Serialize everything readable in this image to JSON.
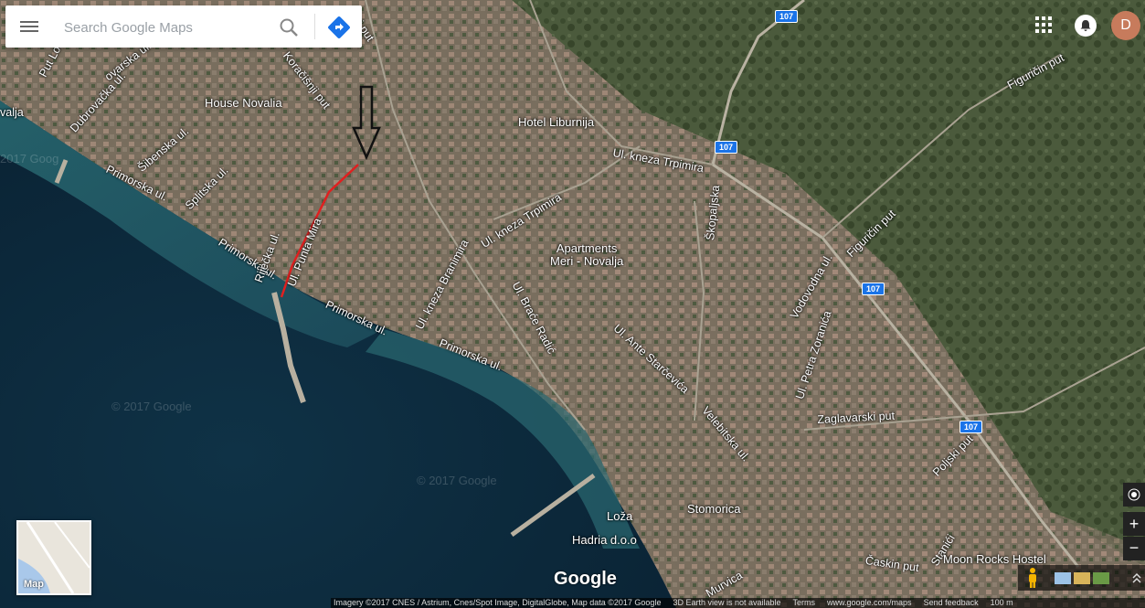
{
  "search": {
    "placeholder": "Search Google Maps"
  },
  "account": {
    "initial": "D"
  },
  "map": {
    "labels": [
      {
        "id": "put-loke",
        "text": "Put Loke"
      },
      {
        "id": "dubrovacka",
        "text": "Dubrovačka ul."
      },
      {
        "id": "ovarska",
        "text": "ovarska ul."
      },
      {
        "id": "novalja",
        "text": "valja"
      },
      {
        "id": "sibenska",
        "text": "Šibenska ul."
      },
      {
        "id": "splitska",
        "text": "Splitska ul."
      },
      {
        "id": "primorska-1",
        "text": "Primorska ul."
      },
      {
        "id": "primorska-2",
        "text": "Primorska ul."
      },
      {
        "id": "primorska-3",
        "text": "Primorska ul."
      },
      {
        "id": "primorska-4",
        "text": "Primorska ul."
      },
      {
        "id": "rijecka",
        "text": "Riječka ul."
      },
      {
        "id": "punta-mira",
        "text": "Ul. Punta Mira"
      },
      {
        "id": "house-novalia",
        "text": "House Novalia"
      },
      {
        "id": "koracisnji",
        "text": "Koračišnji put"
      },
      {
        "id": "ski-put",
        "text": "ški put"
      },
      {
        "id": "hotel-liburnija",
        "text": "Hotel Liburnija"
      },
      {
        "id": "kneza-trpimira-1",
        "text": "Ul. kneza Trpimira"
      },
      {
        "id": "kneza-trpimira-2",
        "text": "Ul. kneza Trpimira"
      },
      {
        "id": "kneza-branimira",
        "text": "Ul. kneza Branimira"
      },
      {
        "id": "apartments-meri",
        "text": "Apartments\nMeri - Novalja"
      },
      {
        "id": "braee-radic",
        "text": "Ul. Braće Radić"
      },
      {
        "id": "ante-starcevica",
        "text": "Ul. Ante Starčevića"
      },
      {
        "id": "skopaljska",
        "text": "Škopaljska"
      },
      {
        "id": "vodovodna",
        "text": "Vodovodna ul."
      },
      {
        "id": "petra-zoranica",
        "text": "Ul. Petra Zoranića"
      },
      {
        "id": "figurcin-1",
        "text": "Figuričin put"
      },
      {
        "id": "figurcin-2",
        "text": "Figuričin put"
      },
      {
        "id": "velebitska",
        "text": "Velebitska ul."
      },
      {
        "id": "zaglavarski",
        "text": "Zaglavarski put"
      },
      {
        "id": "poljski",
        "text": "Poljski put"
      },
      {
        "id": "stomorica",
        "text": "Stomorica"
      },
      {
        "id": "loza",
        "text": "Loža"
      },
      {
        "id": "hadria",
        "text": "Hadria d.o.o"
      },
      {
        "id": "caskin",
        "text": "Časkin put"
      },
      {
        "id": "stanici",
        "text": "Stanići"
      },
      {
        "id": "moon-rocks",
        "text": "Moon Rocks Hostel"
      },
      {
        "id": "murvica",
        "text": "Murvica"
      }
    ],
    "route_shields": [
      "107",
      "107",
      "107",
      "107"
    ],
    "watermarks": [
      "2017 Goog",
      "© 2017 Google",
      "© 2017 Google"
    ],
    "colors": {
      "sea_deep": "#0e2a3c",
      "sea_shallow": "#2d6f78",
      "land": "#5f6b50",
      "town": "#8a7f6f",
      "highlight_road": "#e02020"
    }
  },
  "minimap": {
    "label": "Map"
  },
  "controls": {
    "zoom_in": "+",
    "zoom_out": "−"
  },
  "logo": "Google",
  "footer": {
    "imagery": "Imagery ©2017 CNES / Astrium, Cnes/Spot Image, DigitalGlobe, Map data ©2017 Google",
    "earth": "3D Earth view is not available",
    "terms": "Terms",
    "url": "www.google.com/maps",
    "feedback": "Send feedback",
    "scale": "100 m"
  }
}
